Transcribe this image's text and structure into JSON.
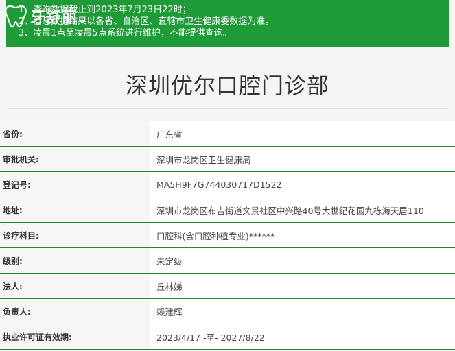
{
  "notice": {
    "lines": [
      "1、查询数据截止到2023年7月23日22时；",
      "2、信息数据结果以各省、自治区、直辖市卫生健康委数据为准。",
      "3、凌晨1点至凌晨5点系统进行维护，不能提供查询。"
    ],
    "bg_color": "#1e9a36"
  },
  "logo": {
    "brand": "牙舒丽",
    "icon": "tooth-icon"
  },
  "clinic": {
    "title": "深圳优尔口腔门诊部"
  },
  "details": [
    {
      "label": "省份:",
      "value": "广东省"
    },
    {
      "label": "审批机关:",
      "value": "深圳市龙岗区卫生健康局"
    },
    {
      "label": "登记号:",
      "value": "MA5H9F7G744030717D1522"
    },
    {
      "label": "地址:",
      "value": "深圳市龙岗区布吉街道文景社区中兴路40号大世纪花园九栋海天居110"
    },
    {
      "label": "诊疗科目:",
      "value": "口腔科(含口腔种植专业)******"
    },
    {
      "label": "级别:",
      "value": "未定级"
    },
    {
      "label": "法人:",
      "value": "丘林娣"
    },
    {
      "label": "负责人:",
      "value": "赖建辉"
    },
    {
      "label": "执业许可证有效期:",
      "value": "2023/4/17 -至- 2027/8/22"
    }
  ],
  "colors": {
    "accent": "#1b8a33",
    "title_text": "#333333"
  }
}
